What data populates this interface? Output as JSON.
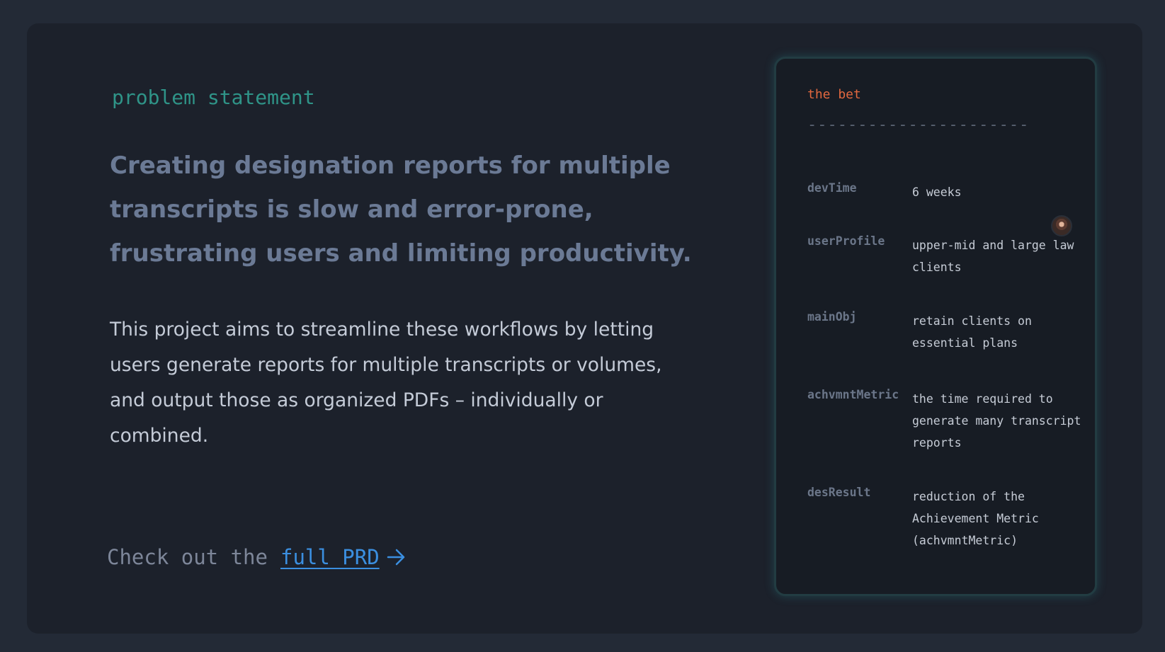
{
  "left": {
    "eyebrow": "problem statement",
    "headline": "Creating designation reports for multiple transcripts is slow and error-prone, frustrating users and limiting productivity.",
    "body": "This project aims to streamline these workflows by letting users generate reports for multiple transcripts or volumes, and output those as organized PDFs – individually or combined.",
    "cta": {
      "prefix": "Check out the",
      "link_label": "full PRD",
      "arrow_icon": "arrow-right-icon"
    }
  },
  "card": {
    "title": "the bet",
    "divider": "----------------------",
    "rows": [
      {
        "key": "devTime",
        "value": "6 weeks"
      },
      {
        "key": "userProfile",
        "value": "upper-mid and large law clients"
      },
      {
        "key": "mainObj",
        "value": "retain clients on essential plans"
      },
      {
        "key": "achvmntMetric",
        "value": "the time required to generate many transcript reports"
      },
      {
        "key": "desResult",
        "value": "reduction of the Achievement Metric (achvmntMetric)"
      }
    ]
  },
  "colors": {
    "background": "#232a36",
    "panel": "#1c212b",
    "eyebrow": "#2f9488",
    "headline": "#6b7a95",
    "link": "#3b8fe0",
    "card_title": "#e2683f"
  }
}
